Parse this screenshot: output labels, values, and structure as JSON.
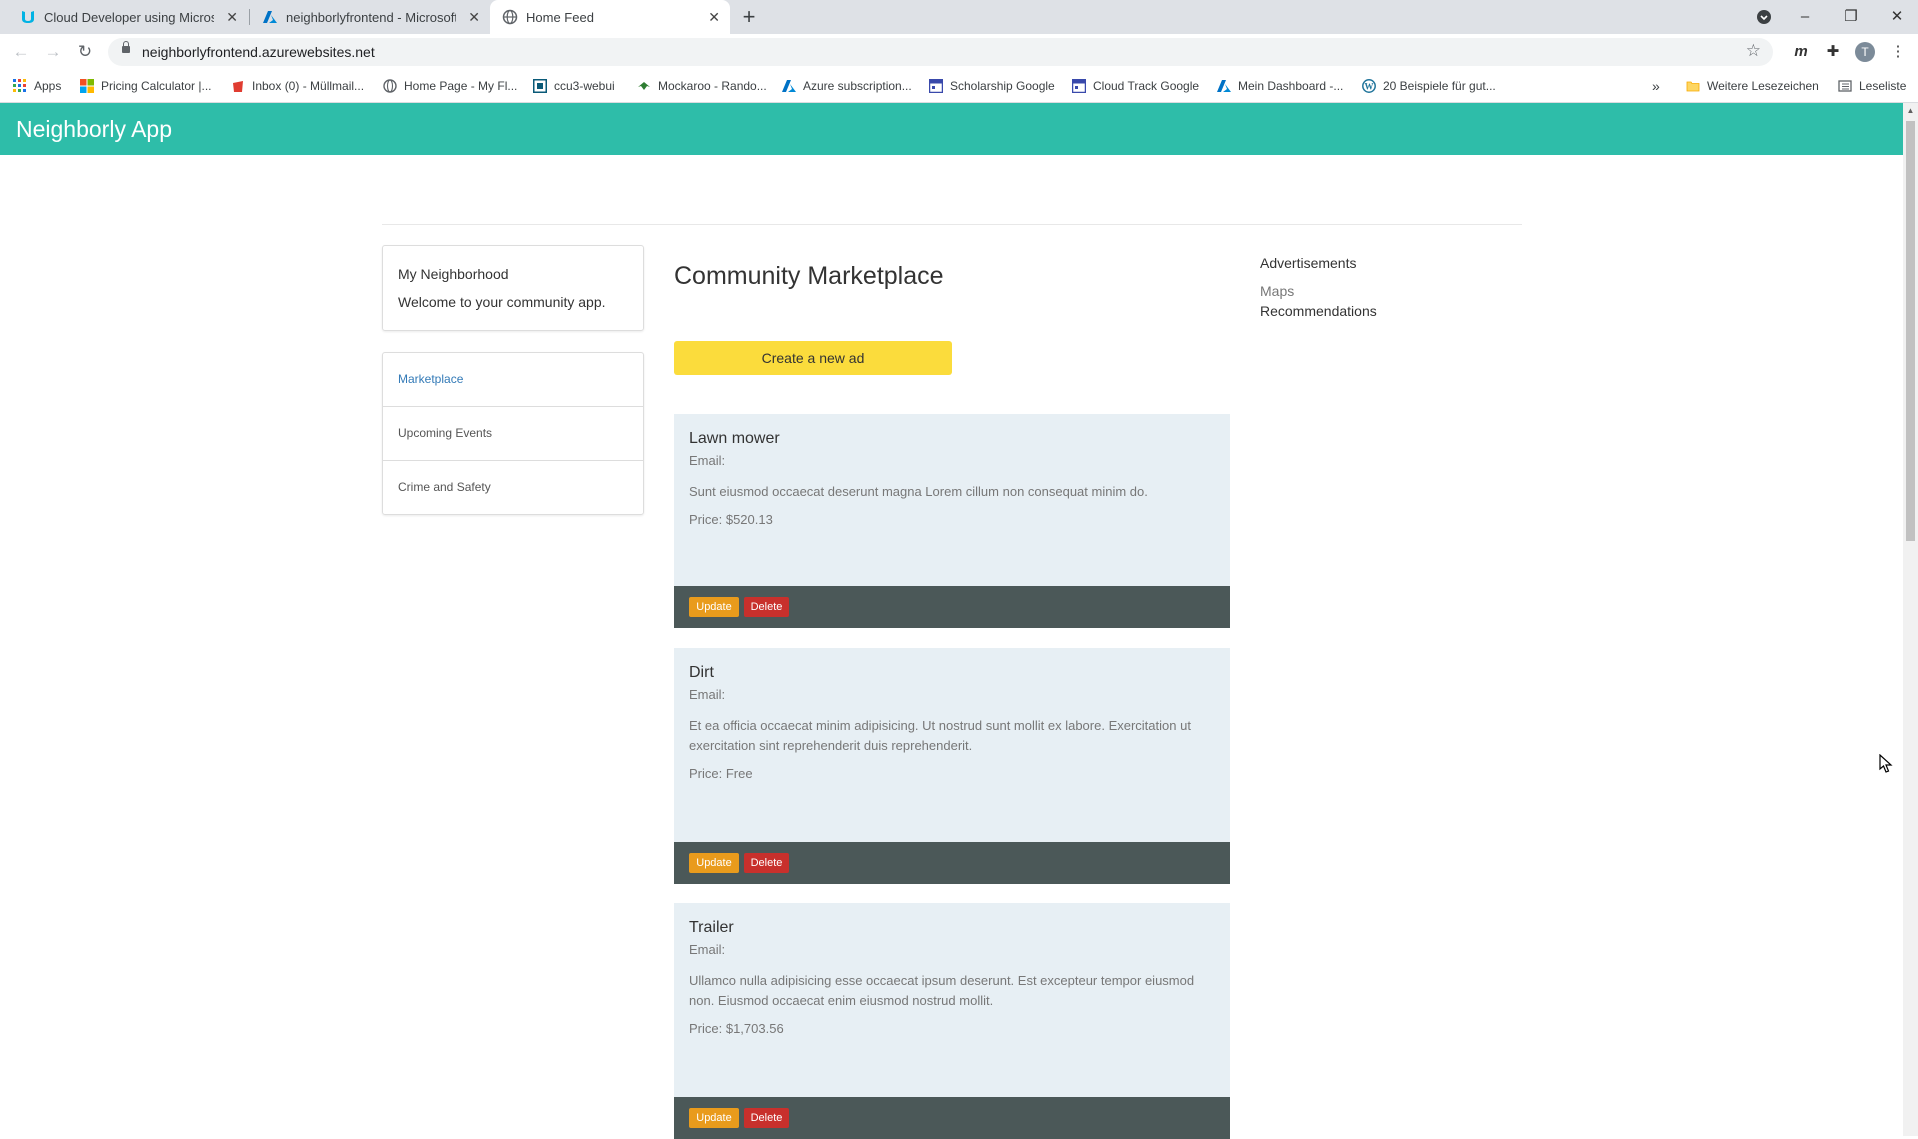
{
  "browser": {
    "tabs": [
      {
        "title": "Cloud Developer using Microsoft",
        "icon": "udacity-icon"
      },
      {
        "title": "neighborlyfrontend - Microsoft A",
        "icon": "azure-icon"
      },
      {
        "title": "Home Feed",
        "icon": "globe-icon",
        "active": true
      }
    ],
    "new_tab": "+",
    "url": "neighborlyfrontend.azurewebsites.net",
    "profile_initial": "T",
    "bookmarks": [
      {
        "label": "Apps",
        "icon": "apps-grid-icon"
      },
      {
        "label": "Pricing Calculator |...",
        "icon": "microsoft-icon"
      },
      {
        "label": "Inbox (0) - Müllmail...",
        "icon": "mail-icon"
      },
      {
        "label": "Home Page - My Fl...",
        "icon": "globe-icon"
      },
      {
        "label": "ccu3-webui",
        "icon": "webui-icon"
      },
      {
        "label": "Mockaroo - Rando...",
        "icon": "mockaroo-icon"
      },
      {
        "label": "Azure subscription...",
        "icon": "azure-icon"
      },
      {
        "label": "Scholarship Google",
        "icon": "calendar-icon"
      },
      {
        "label": "Cloud Track Google",
        "icon": "calendar-icon"
      },
      {
        "label": "Mein Dashboard -...",
        "icon": "azure-icon"
      },
      {
        "label": "20 Beispiele für gut...",
        "icon": "wordpress-icon"
      }
    ],
    "more_bookmarks": "»",
    "other_bookmarks": "Weitere Lesezeichen",
    "reading_list": "Leseliste"
  },
  "app": {
    "brand": "Neighborly App",
    "intro": {
      "title": "My Neighborhood",
      "text": "Welcome to your community app."
    },
    "nav": [
      "Marketplace",
      "Upcoming Events",
      "Crime and Safety"
    ],
    "page_title": "Community Marketplace",
    "create_button": "Create a new ad",
    "ads": [
      {
        "title": "Lawn mower",
        "email": "Email:",
        "description": "Sunt eiusmod occaecat deserunt magna Lorem cillum non consequat minim do.",
        "price": "Price: $520.13"
      },
      {
        "title": "Dirt",
        "email": "Email:",
        "description": "Et ea officia occaecat minim adipisicing. Ut nostrud sunt mollit ex labore. Exercitation ut exercitation sint reprehenderit duis reprehenderit.",
        "price": "Price: Free"
      },
      {
        "title": "Trailer",
        "email": "Email:",
        "description": "Ullamco nulla adipisicing esse occaecat ipsum deserunt. Est excepteur tempor eiusmod non. Eiusmod occaecat enim eiusmod nostrud mollit.",
        "price": "Price: $1,703.56"
      }
    ],
    "update_label": "Update",
    "delete_label": "Delete",
    "sidebar_right": {
      "title": "Advertisements",
      "links": [
        "Maps",
        "Recommendations"
      ]
    },
    "colors": {
      "header": "#2ebda9",
      "create_button": "#fbdc3c",
      "update": "#e99b1c",
      "delete": "#c8302c",
      "card_bg": "#e7eff4",
      "card_footer": "#4b5858"
    }
  }
}
